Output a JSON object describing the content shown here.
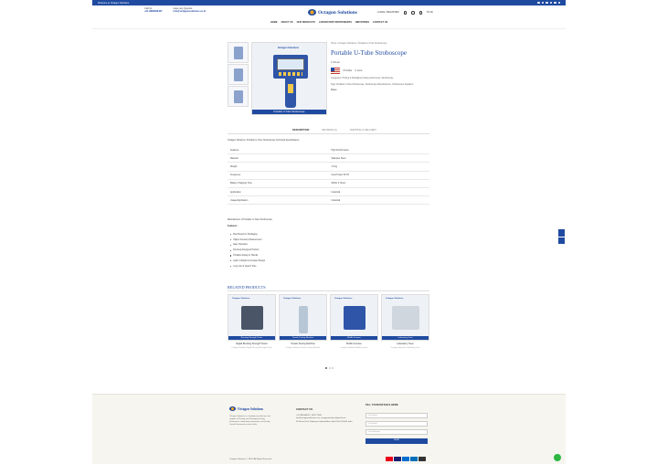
{
  "topbar": {
    "text": "Welcome to Octagon Solutions"
  },
  "header": {
    "call_label": "Call Us",
    "call_value": "+91 9899480427",
    "mail_label": "Have any Queries",
    "mail_value": "info@octagonsolutions.co.in",
    "logo_text": "Octagon Solutions",
    "login_label": "LOGIN / REGISTER",
    "cart_total": "₹0.00"
  },
  "nav": [
    "HOME",
    "ABOUT US",
    "OUR PRODUCTS",
    "LABORATORY INSTRUMENTS",
    "INDUSTRIES",
    "CONTACT US"
  ],
  "product": {
    "breadcrumb": "Home / Octagon Solutions / Portable U-Tube Stroboscope",
    "title": "Portable U-Tube Stroboscope",
    "price": "1 Piece",
    "origin": "US Dollar",
    "stock": "In stock",
    "category": "Categories: Printing & Packaging Testing Instruments, Stroboscope",
    "tags": "Tags: Portable U-Tube Stroboscope, Stroboscope Manufacturers, Stroboscope Suppliers",
    "share": "Share:",
    "image_brand": "Octagon Solutions",
    "image_caption": "Portable U-Tube Stroboscope"
  },
  "tabs": [
    "DESCRIPTION",
    "REVIEWS (0)",
    "SHIPPING & DELIVERY"
  ],
  "description": {
    "intro": "Octagon Solutions: Portable U-Tube Stroboscope Technical Specifications",
    "specs": [
      [
        "Features",
        "High Performance"
      ],
      [
        "Material",
        "Stainless Steel"
      ],
      [
        "Weight",
        "1.5 kg"
      ],
      [
        "Frequency",
        "Input Power 50 Hz"
      ],
      [
        "Battery Charging Time",
        "Within 4 Hours"
      ],
      [
        "Application",
        "Industrial"
      ],
      [
        "Usage/Application",
        "Industrial"
      ]
    ],
    "manufacturer": "Manufacturer of Portable U-Tube Stroboscope",
    "features_heading": "Features",
    "features": [
      "Best Result for Packaging",
      "Higher Accuracy Measurement",
      "Easy Operation",
      "Precisely Designed Product",
      "Portable & Easy to Handle",
      "Light in Weight & Compact Design",
      "Long Life of Quartz Tube"
    ]
  },
  "related": {
    "heading": "RELATED PRODUCTS",
    "items": [
      {
        "brand": "Octagon Solutions",
        "label": "Bursting Strength Tester",
        "name": "Digital Bursting Strength Tester",
        "desc": "Octagon Solutions Digital Bursting Strength Tester",
        "color": "#4a5568"
      },
      {
        "brand": "Octagon Solutions",
        "label": "Tensile Testing Machine",
        "name": "Tensile Testing Machine",
        "desc": "Octagon Solutions Tensile Testing Machine",
        "color": "#b8c7d6"
      },
      {
        "brand": "Octagon Solutions",
        "label": "Muffle Furnace",
        "name": "Muffle Furnace",
        "desc": "Octagon Solutions Muffle Furnace",
        "color": "#2f55a8"
      },
      {
        "brand": "Octagon Solutions",
        "label": "Laboratory Oven",
        "name": "Laboratory Oven",
        "desc": "Octagon Solutions Laboratory Oven",
        "color": "#cfd6de"
      }
    ]
  },
  "footer": {
    "logo_text": "Octagon Solutions",
    "about": "Octagon Solutions is a leading manufacturer and supplier of Printing and Packaging Testing Instruments, Laboratory Instruments and Quality Control Instruments across India.",
    "contact_heading": "CONTACT US",
    "phone": "+91 9899480427, 9911771651",
    "email": "info@octagonsolutions.co.in, octagonsolutions@gmail.com",
    "address": "33 Sector Ext 2, Badarpur Industrial Area, New Delhi 110044, India",
    "form_heading": "FILL YOUR DETAILS HERE",
    "name_placeholder": "Your Name",
    "email_placeholder": "Your Email",
    "message_placeholder": "Your Message",
    "send_label": "SEND",
    "copyright": "Octagon Solutions © 2024. All Rights Reserved."
  },
  "payment_colors": [
    "#eb001b",
    "#1a1f71",
    "#006fcf",
    "#0070ba",
    "#333"
  ]
}
